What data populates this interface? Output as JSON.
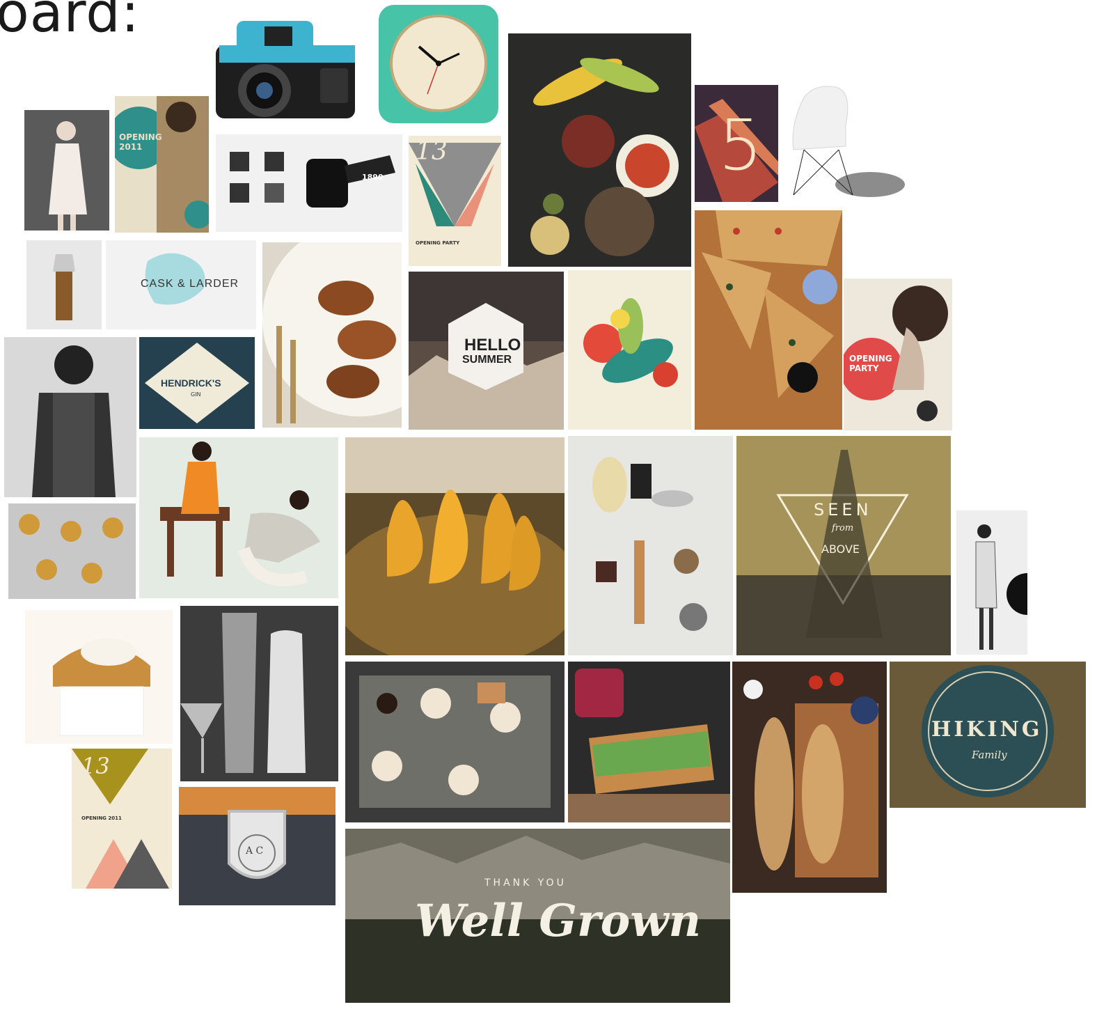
{
  "heading": "oard:",
  "tiles": {
    "opening_2011_poster": {
      "text": "OPENING 2011"
    },
    "cask_larder": {
      "text": "CASK & LARDER"
    },
    "hendricks": {
      "text": "HENDRICK'S",
      "sub": "GIN"
    },
    "poster_13_opening_party": {
      "number": "13",
      "text": "OPENING PARTY"
    },
    "number_5": {
      "text": "5"
    },
    "hello_summer": {
      "line1": "HELLO",
      "line2": "SUMMER"
    },
    "opening_party_red": {
      "text": "OPENING PARTY"
    },
    "seen_from_above": {
      "line1": "SEEN",
      "line2": "from",
      "line3": "ABOVE"
    },
    "hiking": {
      "text": "HIKING",
      "sub": "Family"
    },
    "poster_13_bottom": {
      "number": "13",
      "text": "OPENING 2011"
    },
    "ac_badge": {
      "text": "A C"
    },
    "well_grown": {
      "small": "THANK YOU",
      "text": "Well Grown"
    },
    "c_logo": {
      "badge": "1890"
    }
  },
  "colors": {
    "teal": "#3fa79b",
    "coral": "#e4624f",
    "navy": "#20384a",
    "cream": "#f3ead6",
    "wood": "#8b5a2b"
  }
}
